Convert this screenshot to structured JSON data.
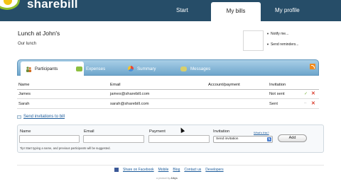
{
  "app": {
    "logo_text": "sharebill"
  },
  "nav": {
    "items": [
      "Start",
      "My bills",
      "My profile"
    ],
    "active": "My bills"
  },
  "bill": {
    "title": "Lunch at John's",
    "subtitle": "Our lunch"
  },
  "side_links": {
    "notify": "Notify me...",
    "reminders": "Send reminders..."
  },
  "tabs": {
    "labels": [
      "Participants",
      "Expenses",
      "Summary",
      "Messages"
    ],
    "active": "Participants"
  },
  "table": {
    "headers": {
      "name": "Name",
      "email": "Email",
      "account": "Account/payment",
      "invitation": "Invitation"
    },
    "rows": [
      {
        "name": "James",
        "email": "james@sharebill.com",
        "account": "",
        "invitation": "Not sent"
      },
      {
        "name": "Sarah",
        "email": "sarah@sharebill.com",
        "account": "",
        "invitation": "Sent"
      }
    ]
  },
  "send_invitations": "Send invitations to bill",
  "form": {
    "labels": {
      "name": "Name",
      "email": "Email",
      "payment": "Payment",
      "invitation": "Invitation"
    },
    "whats_this": "What's this?",
    "invitation_value": "Send invitation",
    "add_label": "Add",
    "tip": "Tip! Start typing a name, and previous participants will be suggested."
  },
  "footer": {
    "links": [
      "Share on Facebook",
      "Mobile",
      "Blog",
      "Contact us",
      "Developers"
    ],
    "powered": "a product by",
    "company": "Albys"
  },
  "colors": {
    "header": "#264d68",
    "accent": "#8fbf2e",
    "tab_strip": "#6ea6cc",
    "link": "#1a5a9a"
  }
}
